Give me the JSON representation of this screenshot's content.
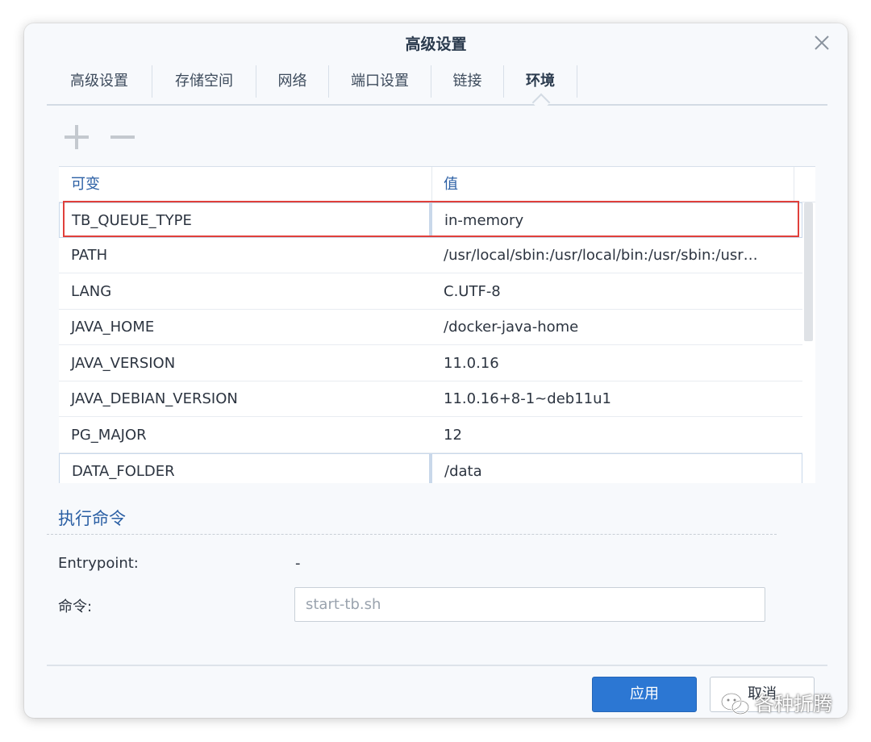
{
  "dialog": {
    "title": "高级设置"
  },
  "tabs": [
    {
      "label": "高级设置"
    },
    {
      "label": "存储空间"
    },
    {
      "label": "网络"
    },
    {
      "label": "端口设置"
    },
    {
      "label": "链接"
    },
    {
      "label": "环境",
      "active": true
    }
  ],
  "toolbar": {
    "add_icon": "plus-icon",
    "remove_icon": "minus-icon"
  },
  "env_table": {
    "headers": {
      "key": "可变",
      "value": "值"
    },
    "rows": [
      {
        "key": "TB_QUEUE_TYPE",
        "value": "in-memory"
      },
      {
        "key": "PATH",
        "value": "/usr/local/sbin:/usr/local/bin:/usr/sbin:/usr…"
      },
      {
        "key": "LANG",
        "value": "C.UTF-8"
      },
      {
        "key": "JAVA_HOME",
        "value": "/docker-java-home"
      },
      {
        "key": "JAVA_VERSION",
        "value": "11.0.16"
      },
      {
        "key": "JAVA_DEBIAN_VERSION",
        "value": "11.0.16+8-1~deb11u1"
      },
      {
        "key": "PG_MAJOR",
        "value": "12"
      },
      {
        "key": "DATA_FOLDER",
        "value": "/data"
      }
    ]
  },
  "exec_section": {
    "title": "执行命令",
    "entrypoint_label": "Entrypoint:",
    "entrypoint_value": "-",
    "command_label": "命令:",
    "command_placeholder": "start-tb.sh"
  },
  "footer": {
    "apply_label": "应用",
    "cancel_label": "取消"
  },
  "watermark": {
    "text": "各种折腾"
  },
  "colors": {
    "accent": "#2c77d3",
    "section_title": "#2b5fa4",
    "highlight_border": "#e0403b"
  }
}
